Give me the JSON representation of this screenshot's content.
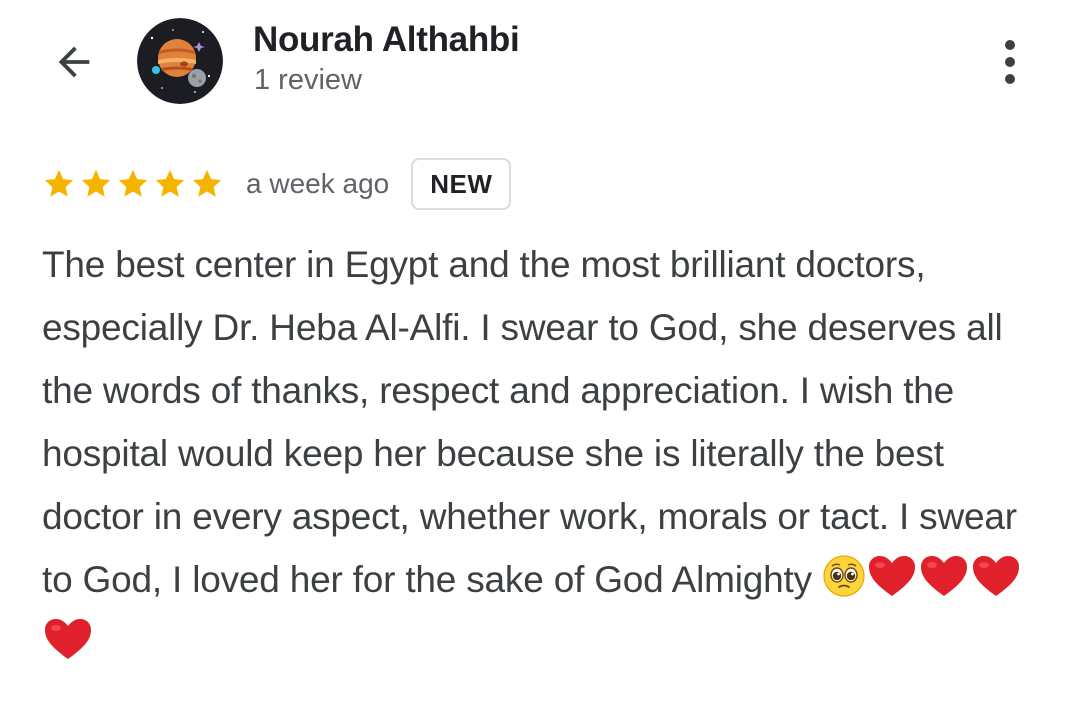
{
  "header": {
    "back_icon": "arrow-back-icon",
    "avatar_icon": "planets-avatar",
    "user_name": "Nourah Althahbi",
    "review_count": "1 review",
    "more_icon": "more-vert-icon"
  },
  "review": {
    "rating": 5,
    "rating_max": 5,
    "star_color": "#f4b400",
    "time_ago": "a week ago",
    "badge": "NEW",
    "text": "The best center in Egypt and the most brilliant doctors, especially Dr. Heba Al-Alfi. I swear to God, she deserves all the words of thanks, respect and appreciation. I wish the hospital would keep her because she is literally the best doctor in every aspect, whether work, morals or tact. I swear to God, I loved her for the sake of God Almighty",
    "emojis": [
      "pleading-face",
      "red-heart",
      "red-heart",
      "red-heart",
      "red-heart"
    ]
  },
  "colors": {
    "text_primary": "#202124",
    "text_secondary": "#5f6368",
    "heart": "#e0202a",
    "badge_border": "#dadce0"
  }
}
